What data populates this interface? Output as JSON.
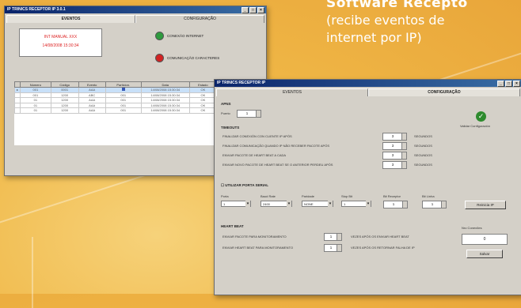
{
  "colors": {
    "accent_red": "#d22222",
    "accent_green": "#2e9b3e",
    "title_blue": "#0a246a",
    "background": "#f0b847"
  },
  "headline": {
    "line1": "Software Recepto",
    "line2": "(recibe eventos de",
    "line3": "internet por IP)"
  },
  "window1": {
    "title": "IP TRINICS RECEPTOR IP 3.0.1",
    "tabs": [
      "EVENTOS",
      "CONFIGURAÇÃO"
    ],
    "message_lines": [
      "INT MANUAL XXX",
      "14/08/2008 15:30:34"
    ],
    "status": [
      {
        "label": "CONEXÃO INTERNET",
        "color": "#2e9b3e",
        "icon": "connection-ok-icon"
      },
      {
        "label": "COMUNICAÇÃO CARACTERES",
        "color": "#d22222",
        "icon": "comm-error-icon"
      }
    ],
    "table": {
      "columns": [
        "Número",
        "Código",
        "Evento",
        "Particion.",
        "",
        "Data",
        "Estado"
      ],
      "rows": [
        [
          "001",
          "0001",
          "AAA",
          "001",
          "",
          "14/08/2008 15:30:34",
          "OK"
        ],
        [
          "001",
          "1200",
          "ABC",
          "001",
          "",
          "14/08/2008 15:30:34",
          "OK"
        ],
        [
          "01",
          "1200",
          "AAA",
          "001",
          "",
          "14/08/2008 15:30:34",
          "OK"
        ],
        [
          "01",
          "1200",
          "AAA",
          "001",
          "",
          "14/08/2008 15:30:34",
          "OK"
        ],
        [
          "01",
          "1200",
          "AAA",
          "001",
          "",
          "14/08/2008 15:30:34",
          "OK"
        ]
      ]
    }
  },
  "window2": {
    "title": "IP TRINICS RECEPTOR IP",
    "tabs": [
      "EVENTOS",
      "CONFIGURAÇÃO"
    ],
    "apns": {
      "title": "APNS",
      "field_label": "Puerto",
      "value": "1"
    },
    "validate_label": "Validar Configuración",
    "timeouts": {
      "title": "TIMEOUTS",
      "rows": [
        {
          "label": "FINALIZAR CONEXIÓN CON CLIENTE IP APÓS",
          "value": "3",
          "unit": "SEGUNDOS"
        },
        {
          "label": "FINALIZAR COMUNICAÇÃO QUANDO IP NÃO RECEBER PACOTE APÓS",
          "value": "3",
          "unit": "SEGUNDOS"
        },
        {
          "label": "ENVIAR PACOTE DE HEART BEAT A CADA",
          "value": "3",
          "unit": "SEGUNDOS"
        },
        {
          "label": "ENVIAR NOVO PACOTE DE HEART BEAT SE O ANTERIOR PERDEU APÓS",
          "value": "3",
          "unit": "SEGUNDOS"
        }
      ]
    },
    "serial": {
      "title": "UTILIZAR PORTA SERIAL",
      "fields": [
        {
          "label": "Porta",
          "value": "1"
        },
        {
          "label": "Baud Rate",
          "value": "2400"
        },
        {
          "label": "Paridade",
          "value": "NONE"
        },
        {
          "label": "Stop Bit",
          "value": "1"
        }
      ],
      "spins": [
        {
          "label": "Bit Receptor",
          "value": "1"
        },
        {
          "label": "Bit Linha",
          "value": "1"
        }
      ],
      "button": "Reinicia IP"
    },
    "heartbeat": {
      "title": "HEART BEAT",
      "rows": [
        {
          "label": "ENVIAR PACOTE PARA MONITORAMENTO",
          "value": "1",
          "unit": "VEZES APÓS OS ENVIAR HEART BEAT"
        },
        {
          "label": "ENVIAR HEART BEAT PARA MONITORAMENTO",
          "value": "1",
          "unit": "VEZES APÓS OS RETORNAR FALHA DE IP"
        }
      ],
      "side_label": "Nro Conexões",
      "side_value": "0",
      "side_button": "Salvar"
    }
  }
}
